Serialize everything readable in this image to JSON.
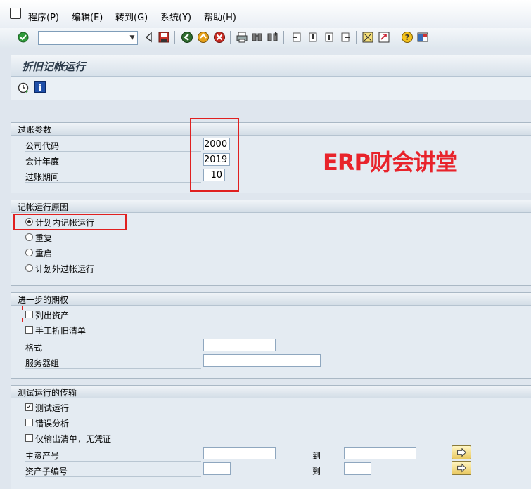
{
  "menu": {
    "items": [
      "程序(P)",
      "编辑(E)",
      "转到(G)",
      "系统(Y)",
      "帮助(H)"
    ]
  },
  "toolbar": {
    "command_field": "",
    "icons": [
      "enter-icon",
      "back-arrow-icon",
      "save-icon",
      "back-icon",
      "exit-icon",
      "cancel-icon",
      "print-icon",
      "find-icon",
      "find-next-icon",
      "first-page-icon",
      "previous-page-icon",
      "next-page-icon",
      "last-page-icon",
      "create-session-icon",
      "shortcut-icon",
      "help-icon",
      "customize-layout-icon"
    ]
  },
  "page": {
    "title": "折旧记帐运行",
    "app_icons": [
      "execute-icon",
      "info-icon"
    ]
  },
  "posting_params": {
    "title": "过账参数",
    "company_code_label": "公司代码",
    "company_code": "2000",
    "fiscal_year_label": "会计年度",
    "fiscal_year": "2019",
    "period_label": "过账期间",
    "period": "10"
  },
  "watermark": "ERP财会讲堂",
  "reason": {
    "title": "记帐运行原因",
    "options": [
      "计划内记帐运行",
      "重复",
      "重启",
      "计划外过帐运行"
    ],
    "selected": 0
  },
  "further": {
    "title": "进一步的期权",
    "list_assets": "列出资产",
    "manual_dep_list": "手工折旧清单",
    "format_label": "格式",
    "format_value": "",
    "server_group_label": "服务器组",
    "server_group_value": ""
  },
  "test": {
    "title": "测试运行的传输",
    "test_run": "测试运行",
    "test_run_checked": true,
    "error_analysis": "错误分析",
    "list_only": "仅输出清单，无凭证",
    "main_asset_label": "主资产号",
    "main_asset_from": "",
    "to_label": "到",
    "main_asset_to": "",
    "sub_asset_label": "资产子编号",
    "sub_asset_from": "",
    "sub_asset_to": ""
  },
  "colors": {
    "accent_red": "#e8232b",
    "background": "#dfe6ee"
  }
}
